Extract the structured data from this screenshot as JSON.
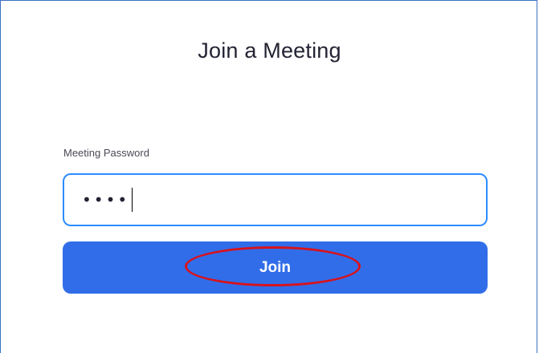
{
  "dialog": {
    "title": "Join a Meeting",
    "password_label": "Meeting Password",
    "password_masked": "••••",
    "join_label": "Join"
  },
  "colors": {
    "primary": "#316de9",
    "input_focus_border": "#2d8cff",
    "frame_border": "#3c6fc4",
    "annotation_red": "#d8121c"
  }
}
